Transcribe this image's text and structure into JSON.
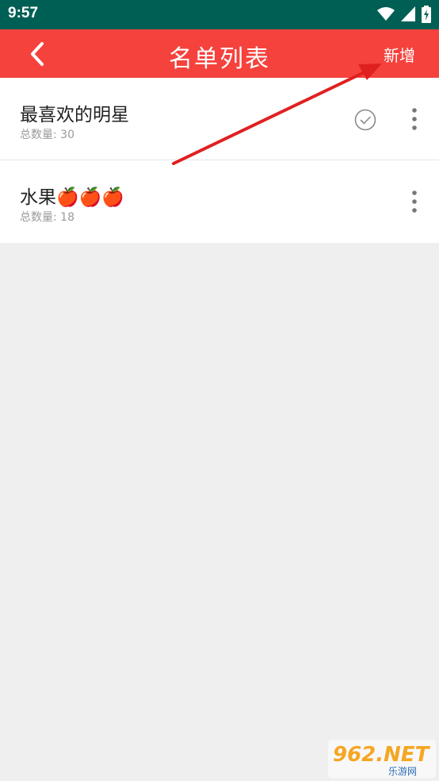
{
  "status_bar": {
    "time": "9:57",
    "icons": [
      "wifi-icon",
      "signal-icon",
      "battery-charging-icon"
    ]
  },
  "app_bar": {
    "back_icon": "chevron-left-icon",
    "title": "名单列表",
    "add_label": "新增",
    "color": "#f5423d"
  },
  "list": {
    "items": [
      {
        "title": "最喜欢的明星",
        "count": "总数量: 30",
        "selected": true
      },
      {
        "title": "水果🍎🍎🍎",
        "count": "总数量: 18",
        "selected": false
      }
    ]
  },
  "watermark": {
    "text": "962.NET",
    "subtext": "乐游网"
  },
  "colors": {
    "status_bar": "#005f54",
    "app_bar": "#f5423d",
    "background": "#efefef",
    "annotation": "#e02020"
  }
}
